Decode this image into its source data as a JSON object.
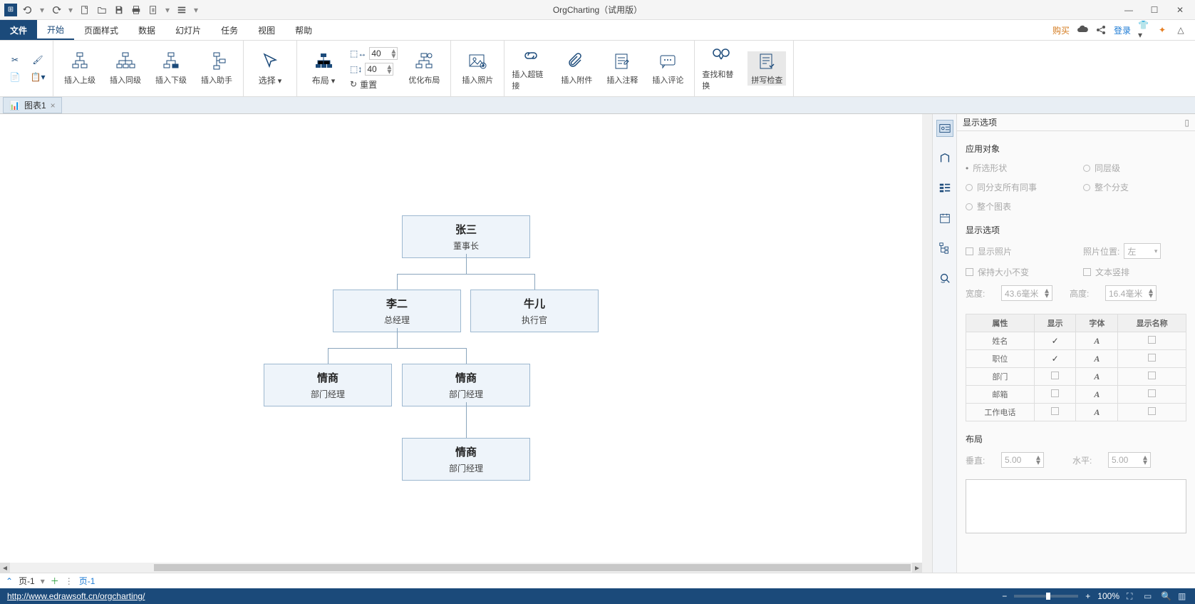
{
  "app": {
    "title": "OrgCharting（试用版）"
  },
  "menus": {
    "file": "文件",
    "start": "开始",
    "page_style": "页面样式",
    "data": "数据",
    "slides": "幻灯片",
    "tasks": "任务",
    "view": "视图",
    "help": "帮助"
  },
  "topright": {
    "buy": "购买",
    "login": "登录"
  },
  "ribbon": {
    "insert_superior": "插入上级",
    "insert_peer": "插入同级",
    "insert_subordinate": "插入下级",
    "insert_assistant": "插入助手",
    "select": "选择",
    "layout": "布局",
    "spacing_h": "40",
    "spacing_v": "40",
    "optimize_layout": "优化布局",
    "reset": "重置",
    "insert_photo": "插入照片",
    "insert_hyperlink": "插入超链接",
    "insert_attachment": "插入附件",
    "insert_note": "插入注释",
    "insert_comment": "插入评论",
    "find_replace": "查找和替换",
    "spell_check": "拼写检查"
  },
  "doc_tab": {
    "name": "图表1"
  },
  "org_chart": {
    "nodes": [
      {
        "id": "n1",
        "name": "张三",
        "title": "董事长"
      },
      {
        "id": "n2",
        "name": "李二",
        "title": "总经理"
      },
      {
        "id": "n3",
        "name": "牛儿",
        "title": "执行官"
      },
      {
        "id": "n4",
        "name": "情商",
        "title": "部门经理"
      },
      {
        "id": "n5",
        "name": "情商",
        "title": "部门经理"
      },
      {
        "id": "n6",
        "name": "情商",
        "title": "部门经理"
      }
    ]
  },
  "panel": {
    "header": "显示选项",
    "apply_to": "应用对象",
    "radios": {
      "selected": "所选形状",
      "same_level": "同层级",
      "same_branch_colleagues": "同分支所有同事",
      "whole_branch": "整个分支",
      "whole_chart": "整个图表"
    },
    "display_options": "显示选项",
    "show_photo": "显示照片",
    "photo_pos_label": "照片位置:",
    "photo_pos_value": "左",
    "keep_size": "保持大小不变",
    "vertical_text": "文本竖排",
    "width_label": "宽度:",
    "width_value": "43.6毫米",
    "height_label": "高度:",
    "height_value": "16.4毫米",
    "table": {
      "headers": {
        "attr": "属性",
        "show": "显示",
        "font": "字体",
        "show_name": "显示名称"
      },
      "rows": [
        {
          "attr": "姓名",
          "show": true
        },
        {
          "attr": "职位",
          "show": true
        },
        {
          "attr": "部门",
          "show": false
        },
        {
          "attr": "邮箱",
          "show": false
        },
        {
          "attr": "工作电话",
          "show": false
        }
      ]
    },
    "layout_title": "布局",
    "vert_label": "垂直:",
    "vert_value": "5.00",
    "horiz_label": "水平:",
    "horiz_value": "5.00"
  },
  "pagebar": {
    "page_left": "页-1",
    "page_right": "页-1"
  },
  "status": {
    "url": "http://www.edrawsoft.cn/orgcharting/",
    "zoom": "100%"
  }
}
